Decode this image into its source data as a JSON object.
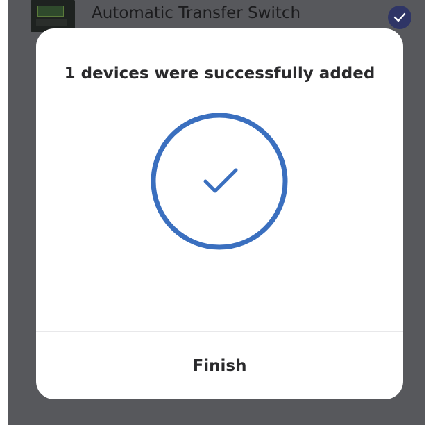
{
  "background_list": {
    "device_name": "Automatic Transfer Switch",
    "device_icon": "device-thumbnail",
    "selected_icon": "check-icon"
  },
  "dialog": {
    "title": "1 devices were successfully added",
    "status_icon": "success-check-icon",
    "finish_label": "Finish"
  },
  "colors": {
    "accent": "#3a6fbf",
    "overlay": "#57585c",
    "selected_badge": "#2f3566"
  }
}
